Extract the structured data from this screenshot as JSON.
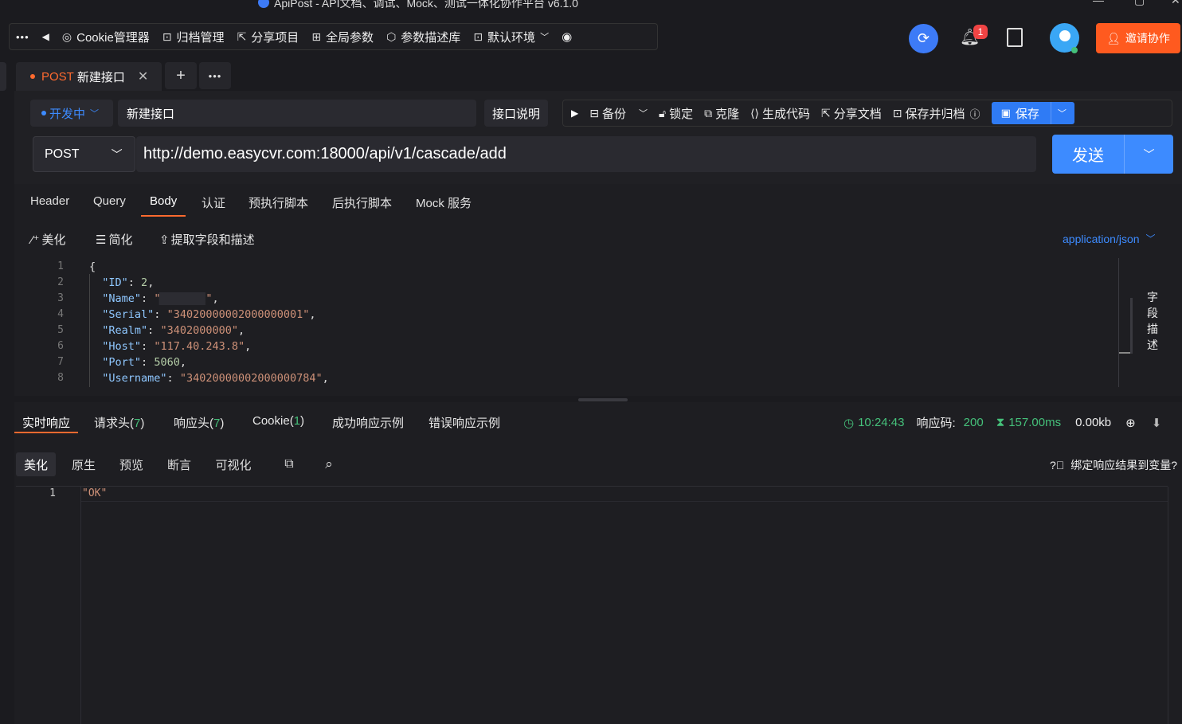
{
  "window": {
    "title": "ApiPost - API文档、调试、Mock、测试一体化协作平台 v6.1.0"
  },
  "toolbar": {
    "more": "•••",
    "back": "◀",
    "items": [
      {
        "label": "Cookie管理器",
        "icon": "cookie-icon"
      },
      {
        "label": "归档管理",
        "icon": "archive-icon"
      },
      {
        "label": "分享项目",
        "icon": "share-icon"
      },
      {
        "label": "全局参数",
        "icon": "params-icon"
      },
      {
        "label": "参数描述库",
        "icon": "cube-icon"
      },
      {
        "label": "默认环境",
        "icon": "env-icon"
      }
    ]
  },
  "header": {
    "notification_count": "1",
    "invite_label": "邀请协作"
  },
  "tab": {
    "method": "POST",
    "name": "新建接口",
    "close": "✕",
    "add": "+",
    "more": "•••"
  },
  "request": {
    "status": "开发中",
    "name": "新建接口",
    "doc_button": "接口说明",
    "actions": {
      "backup": "备份",
      "lock": "锁定",
      "clone": "克隆",
      "gen_code": "生成代码",
      "share_doc": "分享文档",
      "save_archive": "保存并归档",
      "save": "保存"
    },
    "method": "POST",
    "url": "http://demo.easycvr.com:18000/api/v1/cascade/add",
    "send": "发送"
  },
  "body_tabs": [
    "Header",
    "Query",
    "Body",
    "认证",
    "预执行脚本",
    "后执行脚本",
    "Mock 服务"
  ],
  "body_tools": {
    "beautify": "美化",
    "simplify": "简化",
    "extract": "提取字段和描述",
    "content_type": "application/json",
    "field_desc": [
      "字",
      "段",
      "描",
      "述"
    ]
  },
  "body_code": {
    "line_numbers": [
      "1",
      "2",
      "3",
      "4",
      "5",
      "6",
      "7",
      "8"
    ],
    "lines": [
      {
        "text": "{"
      },
      {
        "key": "\"ID\"",
        "value": "2"
      },
      {
        "key": "\"Name\"",
        "value": "\"       \""
      },
      {
        "key": "\"Serial\"",
        "value": "\"34020000002000000001\""
      },
      {
        "key": "\"Realm\"",
        "value": "\"3402000000\""
      },
      {
        "key": "\"Host\"",
        "value": "\"117.40.243.8\""
      },
      {
        "key": "\"Port\"",
        "value": "5060"
      },
      {
        "key": "\"Username\"",
        "value": "\"34020000002000000784\""
      }
    ]
  },
  "response": {
    "tabs": {
      "realtime": "实时响应",
      "req_headers": "请求头(",
      "req_headers_count": "7",
      "resp_headers": "响应头(",
      "resp_headers_count": "7",
      "cookie": "Cookie(",
      "cookie_count": "1",
      "close_paren": ")",
      "success_example": "成功响应示例",
      "error_example": "错误响应示例"
    },
    "time": "10:24:43",
    "code_label": "响应码:",
    "code": "200",
    "duration": "157.00ms",
    "size": "0.00kb",
    "view_tabs": [
      "美化",
      "原生",
      "预览",
      "断言",
      "可视化"
    ],
    "bind_label": "绑定响应结果到变量?",
    "line_number": "1",
    "body": "\"OK\""
  },
  "colors": {
    "accent": "#3d7bf7",
    "orange": "#ff5a1f",
    "green": "#45c07a",
    "badge": "#f04444"
  }
}
